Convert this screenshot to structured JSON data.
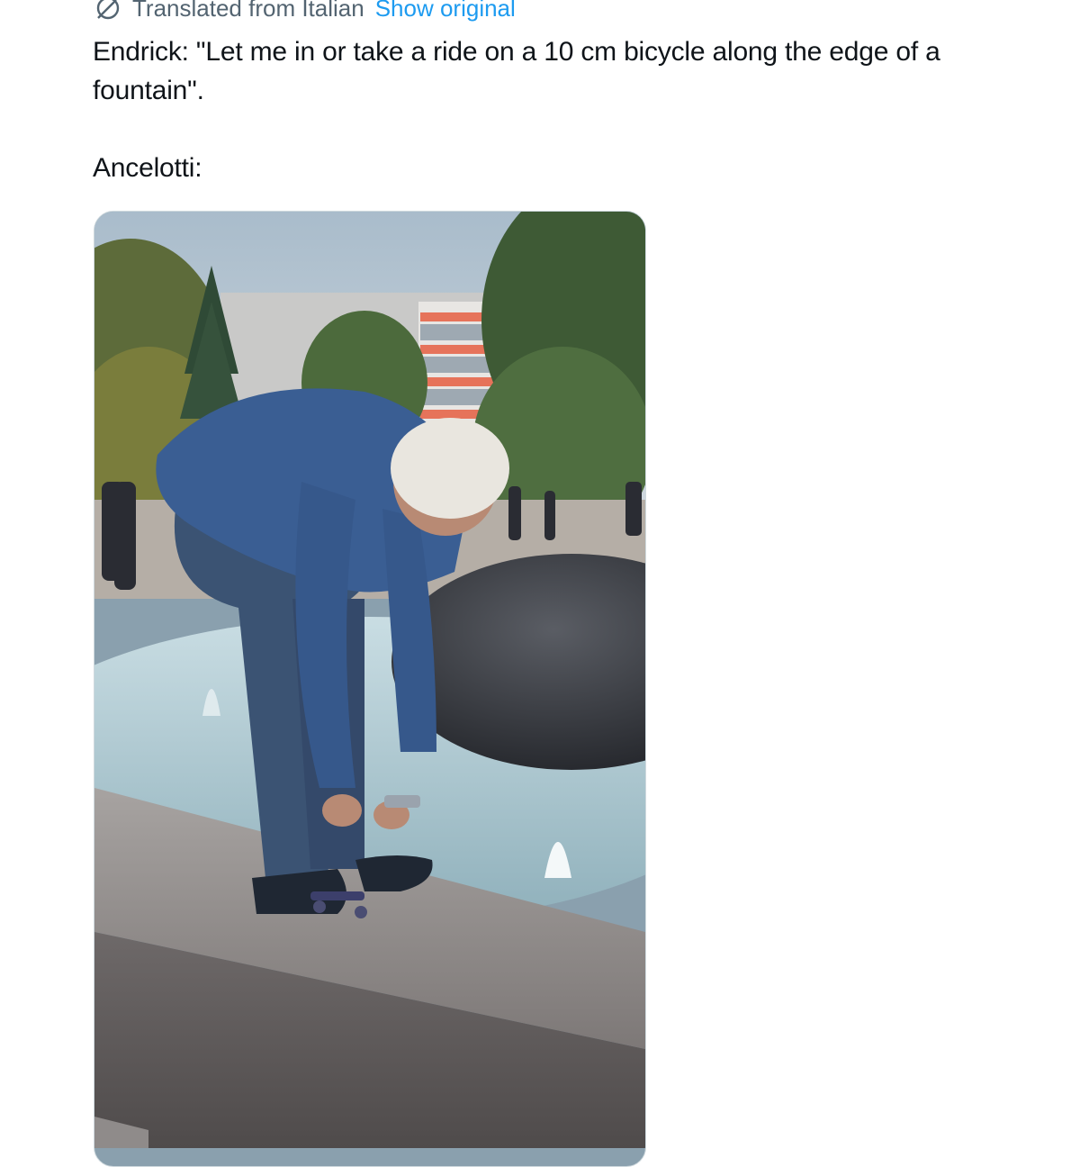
{
  "translation": {
    "icon": "translate-globe-icon",
    "label": "Translated from Italian",
    "action": "Show original"
  },
  "tweet": {
    "line1": "Endrick: \"Let me in or take a ride on a 10 cm bicycle along the edge of a fountain\".",
    "line2": "Ancelotti:"
  },
  "media": {
    "type": "video-thumbnail",
    "icon": "video-still"
  },
  "colors": {
    "link": "#1d9bf0",
    "muted": "#536471",
    "text": "#0f1419",
    "border": "#cfd9de"
  }
}
